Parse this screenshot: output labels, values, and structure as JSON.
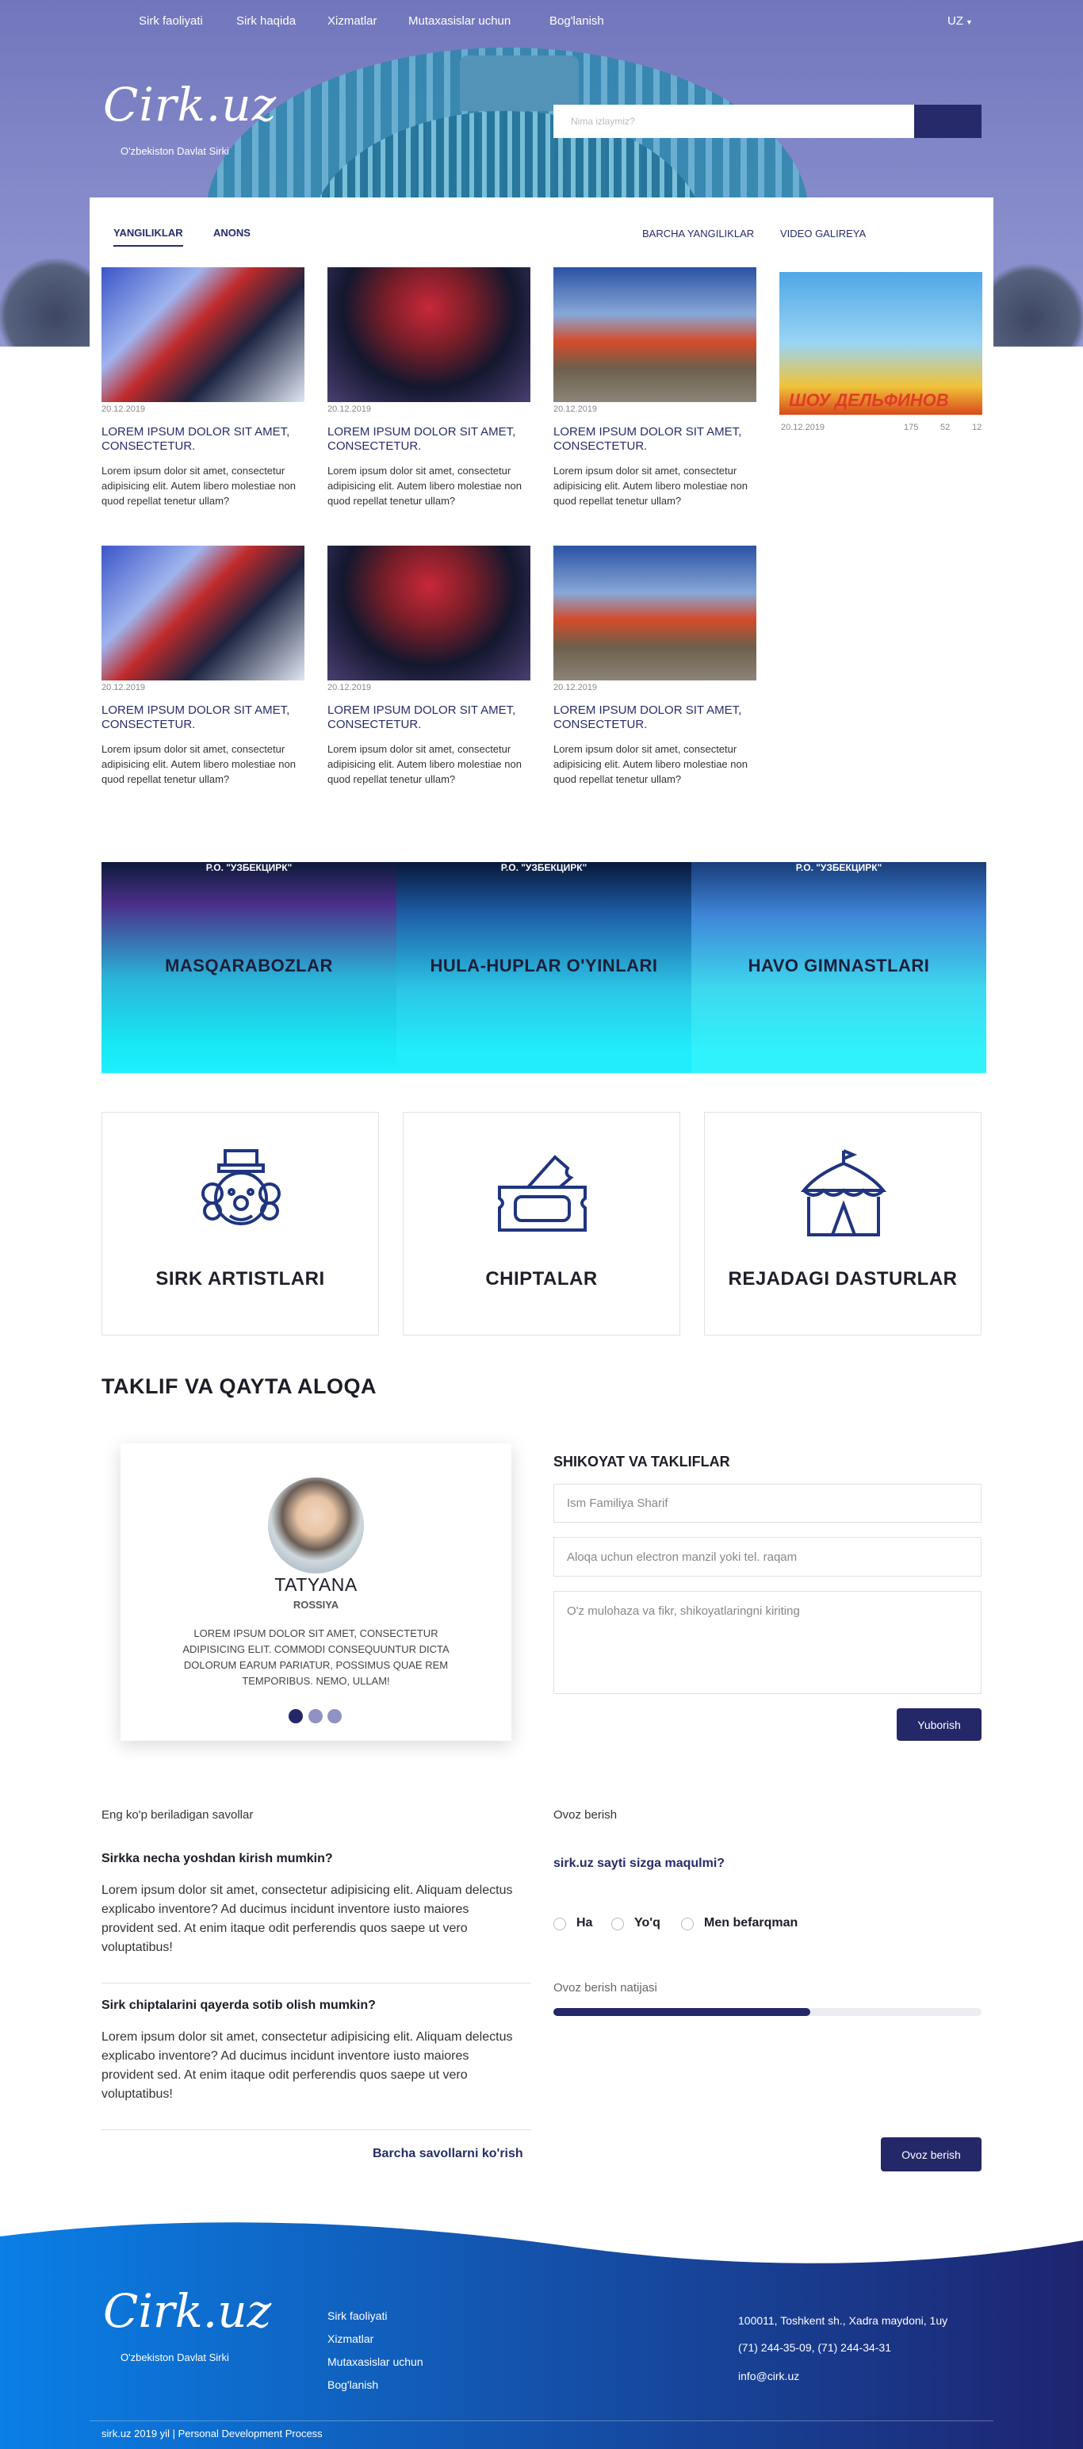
{
  "nav": {
    "items": [
      "Sirk faoliyati",
      "Sirk haqida",
      "Xizmatlar",
      "Mutaxasislar uchun",
      "Bog'lanish"
    ],
    "lang": "UZ"
  },
  "brand": {
    "logo": "Cirk.uz",
    "subtitle": "O'zbekiston Davlat Sirki"
  },
  "search": {
    "placeholder": "Nima izlaymiz?"
  },
  "news": {
    "tabs": [
      "YANGILIKLAR",
      "ANONS"
    ],
    "all_link": "BARCHA YANGILIKLAR",
    "video_link": "VIDEO GALIREYA",
    "cards": [
      {
        "date": "20.12.2019",
        "title": "LOREM IPSUM DOLOR SIT AMET, CONSECTETUR.",
        "text": "Lorem ipsum dolor sit amet, consectetur adipisicing elit. Autem libero molestiae non quod repellat tenetur ullam?"
      },
      {
        "date": "20.12.2019",
        "title": "LOREM IPSUM DOLOR SIT AMET, CONSECTETUR.",
        "text": "Lorem ipsum dolor sit amet, consectetur adipisicing elit. Autem libero molestiae non quod repellat tenetur ullam?"
      },
      {
        "date": "20.12.2019",
        "title": "LOREM IPSUM DOLOR SIT AMET, CONSECTETUR.",
        "text": "Lorem ipsum dolor sit amet, consectetur adipisicing elit. Autem libero molestiae non quod repellat tenetur ullam?"
      },
      {
        "date": "20.12.2019",
        "title": "LOREM IPSUM DOLOR SIT AMET, CONSECTETUR.",
        "text": "Lorem ipsum dolor sit amet, consectetur adipisicing elit. Autem libero molestiae non quod repellat tenetur ullam?"
      },
      {
        "date": "20.12.2019",
        "title": "LOREM IPSUM DOLOR SIT AMET, CONSECTETUR.",
        "text": "Lorem ipsum dolor sit amet, consectetur adipisicing elit. Autem libero molestiae non quod repellat tenetur ullam?"
      },
      {
        "date": "20.12.2019",
        "title": "LOREM IPSUM DOLOR SIT AMET, CONSECTETUR.",
        "text": "Lorem ipsum dolor sit amet, consectetur adipisicing elit. Autem libero molestiae non quod repellat tenetur ullam?"
      }
    ],
    "video": {
      "caption": "ШОУ ДЕЛЬФИНОВ",
      "date": "20.12.2019",
      "stats": [
        "175",
        "52",
        "12"
      ]
    }
  },
  "banners": [
    {
      "title": "MASQARABOZLAR",
      "sub": "Р.О. \"УЗБЕКЦИРК\""
    },
    {
      "title": "HULA-HUPLAR O'YINLARI",
      "sub": "Р.О. \"УЗБЕКЦИРК\""
    },
    {
      "title": "HAVO GIMNASTLARI",
      "sub": "Р.О. \"УЗБЕКЦИРК\""
    }
  ],
  "services": [
    {
      "label": "SIRK ARTISTLARI",
      "icon": "clown-icon"
    },
    {
      "label": "CHIPTALAR",
      "icon": "ticket-icon"
    },
    {
      "label": "REJADAGI DASTURLAR",
      "icon": "circus-tent-icon"
    }
  ],
  "feedback": {
    "title": "TAKLIF VA QAYTA ALOQA",
    "testimonial": {
      "name": "TATYANA",
      "country": "ROSSIYA",
      "text": "LOREM IPSUM DOLOR SIT AMET, CONSECTETUR ADIPISICING ELIT. COMMODI CONSEQUUNTUR DICTA DOLORUM EARUM PARIATUR, POSSIMUS QUAE REM TEMPORIBUS. NEMO, ULLAM!"
    },
    "form": {
      "title": "SHIKOYAT VA TAKLIFLAR",
      "name_placeholder": "Ism Familiya Sharif",
      "contact_placeholder": "Aloqa uchun electron manzil yoki tel. raqam",
      "message_placeholder": "O'z mulohaza va fikr, shikoyatlaringni kiriting",
      "submit": "Yuborish"
    }
  },
  "faq": {
    "heading": "Eng ko'p beriladigan savollar",
    "items": [
      {
        "q": "Sirkka necha yoshdan kirish mumkin?",
        "a": "Lorem ipsum dolor sit amet, consectetur adipisicing elit. Aliquam delectus explicabo inventore? Ad ducimus incidunt inventore iusto maiores provident sed. At enim itaque odit perferendis quos saepe ut vero voluptatibus!"
      },
      {
        "q": "Sirk chiptalarini qayerda sotib olish mumkin?",
        "a": "Lorem ipsum dolor sit amet, consectetur adipisicing elit. Aliquam delectus explicabo inventore? Ad ducimus incidunt inventore iusto maiores provident sed. At enim itaque odit perferendis quos saepe ut vero voluptatibus!"
      }
    ],
    "all_link": "Barcha savollarni ko'rish"
  },
  "poll": {
    "heading": "Ovoz berish",
    "question": "sirk.uz sayti sizga maqulmi?",
    "options": [
      "Ha",
      "Yo'q",
      "Men befarqman"
    ],
    "result_label": "Ovoz berish natijasi",
    "result_fraction": 0.6,
    "button": "Ovoz berish"
  },
  "footer": {
    "links": [
      "Sirk faoliyati",
      "Xizmatlar",
      "Mutaxasislar uchun",
      "Bog'lanish"
    ],
    "address": "100011, Toshkent sh., Xadra maydoni, 1uy",
    "phones": "(71) 244-35-09, (71) 244-34-31",
    "email": "info@cirk.uz",
    "copyright": "sirk.uz 2019 yil | Personal Development Process"
  },
  "colors": {
    "primary": "#242768",
    "footer_start": "#0a7fe6",
    "footer_end": "#1e2470"
  }
}
